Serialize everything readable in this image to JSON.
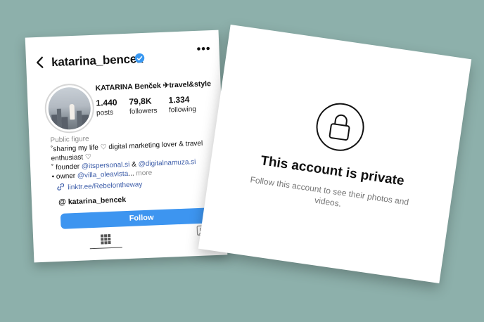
{
  "profile": {
    "username": "katarina_bencek",
    "display_name": "KATARINA Benček ✈travel&style",
    "stats": [
      {
        "value": "1.440",
        "label": "posts"
      },
      {
        "value": "79,8K",
        "label": "followers"
      },
      {
        "value": "1.334",
        "label": "following"
      }
    ],
    "category": "Public figure",
    "bio": {
      "line1": "˚sharing my life ♡ digital marketing lover & travel",
      "line2": "enthusiast ♡",
      "line3_prefix": "˚ founder ",
      "line3_link1": "@itspersonal.si",
      "line3_mid": " & ",
      "line3_link2": "@digitalnamuza.si",
      "line4_prefix": "• owner ",
      "line4_link": "@villa_oleavista",
      "line4_ellipsis": "...",
      "more": " more"
    },
    "url": "linktr.ee/Rebelontheway",
    "threads_handle": "katarina_bencek",
    "follow_label": "Follow",
    "more_menu": "•••"
  },
  "private_notice": {
    "title": "This account is private",
    "subtitle": "Follow this account to see their photos and videos."
  },
  "colors": {
    "background": "#8db0ab",
    "follow_button": "#3d95f0",
    "link": "#3a5ba8",
    "verified": "#3897f0"
  },
  "icons": [
    "back-icon",
    "verified-icon",
    "more-icon",
    "link-icon",
    "threads-icon",
    "grid-icon",
    "tagged-icon",
    "lock-icon"
  ]
}
